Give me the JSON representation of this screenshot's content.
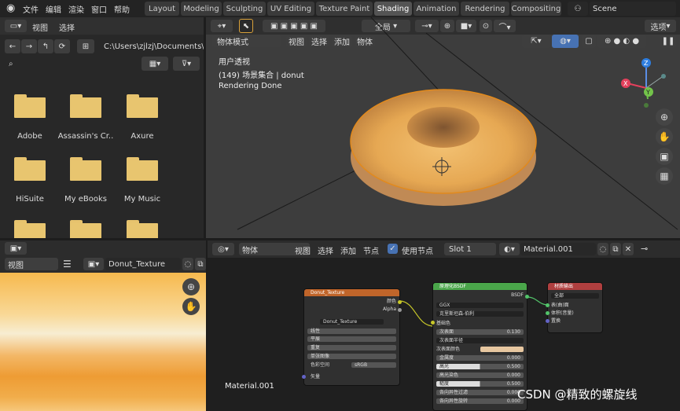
{
  "topbar": {
    "menus": [
      "文件",
      "编辑",
      "渲染",
      "窗口",
      "帮助"
    ],
    "workspaces": [
      "Layout",
      "Modeling",
      "Sculpting",
      "UV Editing",
      "Texture Paint",
      "Shading",
      "Animation",
      "Rendering",
      "Compositing"
    ],
    "active_workspace": "Shading",
    "scene_label": "Scene"
  },
  "file_browser": {
    "header_menus": [
      "视图",
      "选择"
    ],
    "path": "C:\\Users\\zjlzj\\Documents\\",
    "search_placeholder": "",
    "folders": [
      "Adobe",
      "Assassin's Cr..",
      "Axure",
      "HiSuite",
      "My eBooks",
      "My Music",
      "",
      "",
      ""
    ]
  },
  "viewport": {
    "mode": "物体模式",
    "menus": [
      "视图",
      "选择",
      "添加",
      "物体"
    ],
    "transform_orientation": "全局",
    "options_label": "选项",
    "overlay_lines": [
      "用户透视",
      "(149) 场景集合 | donut",
      "Rendering Done"
    ],
    "gizmo_axes": {
      "x": "X",
      "y": "Y",
      "z": "Z"
    }
  },
  "image_editor": {
    "menu": "视图",
    "image_name": "Donut_Texture"
  },
  "node_editor": {
    "object_label": "物体",
    "menus": [
      "视图",
      "选择",
      "添加",
      "节点"
    ],
    "use_nodes_label": "使用节点",
    "slot": "Slot 1",
    "material": "Material.001",
    "material_label": "Material.001",
    "image_node": {
      "title": "Donut_Texture",
      "outputs": [
        "颜色",
        "Alpha"
      ],
      "image_name": "Donut_Texture",
      "options": [
        "线性",
        "平展",
        "重复",
        "单张图像"
      ],
      "colorspace_label": "色彩空间",
      "colorspace": "sRGB",
      "input": "矢量"
    },
    "bsdf_node": {
      "title": "原理化BSDF",
      "output": "BSDF",
      "distribution": "GGX",
      "subsurface_method": "克里斯坦森-伯利",
      "rows": [
        {
          "label": "基础色",
          "value": ""
        },
        {
          "label": "次表面",
          "value": "0.130"
        },
        {
          "label": "次表面半径",
          "value": ""
        },
        {
          "label": "次表面颜色",
          "value": ""
        },
        {
          "label": "金属度",
          "value": "0.000"
        },
        {
          "label": "高光",
          "value": "0.500"
        },
        {
          "label": "高光染色",
          "value": "0.000"
        },
        {
          "label": "糙度",
          "value": "0.500"
        },
        {
          "label": "各向异性过滤",
          "value": "0.000"
        },
        {
          "label": "各向异性旋转",
          "value": "0.000"
        }
      ]
    },
    "output_node": {
      "title": "材质输出",
      "target": "全部",
      "inputs": [
        "表(曲)面",
        "体积(音量)",
        "置换"
      ]
    }
  },
  "watermark": "CSDN @精致的螺旋线",
  "colors": {
    "active_tab": "#545454",
    "accent": "#4772b3",
    "texture_header": "#c0652a",
    "shader_header": "#4aa64a",
    "output_header": "#b03f3f"
  }
}
